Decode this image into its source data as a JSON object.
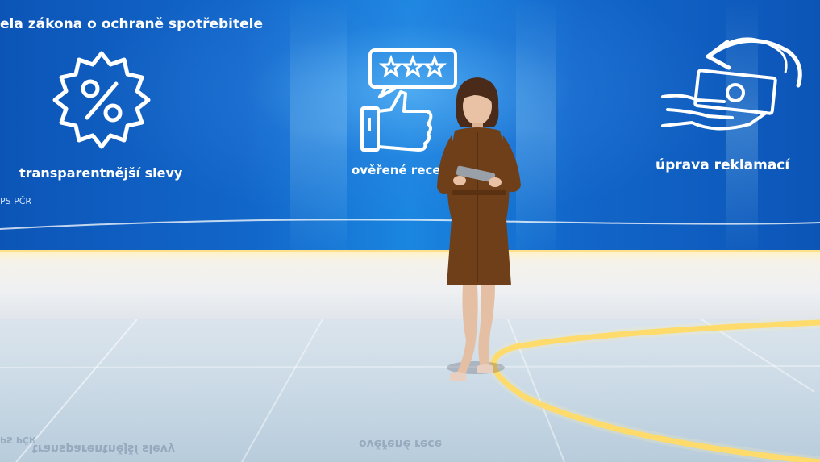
{
  "screen": {
    "title": "ela zákona o ochraně spotřebitele",
    "labels": {
      "discounts": "transparentnější slevy",
      "reviews": "ověřené rece",
      "complaints": "úprava reklamací"
    },
    "source": "PS PČR"
  },
  "reflections": {
    "left": "transparentnější slevy",
    "middle": "ověřené rece",
    "far_left": "PS PČR"
  },
  "icons": [
    "percent-badge-icon",
    "thumbs-up-review-icon",
    "refund-hand-icon"
  ],
  "colors": {
    "screen_blue": "#1266c9",
    "dress": "#6e3f19",
    "floor_light": "#ffd65a"
  }
}
